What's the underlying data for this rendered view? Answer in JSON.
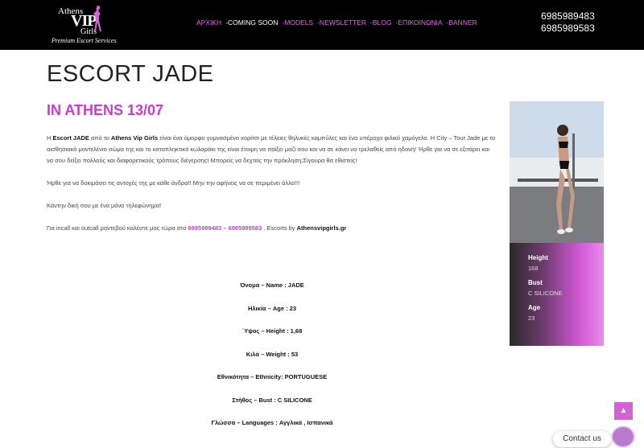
{
  "logo": {
    "line1": "Athens",
    "line2": "VIP",
    "line3": "Girls",
    "tagline": "Premium Escort Services"
  },
  "nav": [
    {
      "label": "ΑΡΧΙΚΗ"
    },
    {
      "label": "-COMING SOON"
    },
    {
      "label": "-MODELS"
    },
    {
      "label": "-NEWSLETTER"
    },
    {
      "label": "-BLOG"
    },
    {
      "label": "-ΕΠΙΚΟΙΝΩΝΙΑ"
    },
    {
      "label": "-BANNER"
    }
  ],
  "phones": [
    "6985989483",
    "6985989583"
  ],
  "page": {
    "title": "ESCORT JADE",
    "subtitle": "IN ATHENS 13/07"
  },
  "body": {
    "p1_a": "Η ",
    "p1_b": "Escort JADE",
    "p1_c": " από το ",
    "p1_d": "Athens Vip Girls",
    "p1_e": " είναι ένα όμορφο γυμνασμένο κορίτσι με τέλειες θηλυκές καμπύλες και ένα υπέροχο φιλικό χαμόγελο. Η City – Tour Jade με το αισθησιακό  μοντελένιο σώμα της και το καταπληκτικό κωλαράκι της είναι έτοιμη να παίξει μαζί σου και να σε κάνει να τρελαθείς από ηδονή!  Ήρθε για να σε εξιτάρει και να σου δείξει πολλούς και διαφορετικούς τρόπους διέγερσης! Μπορείς να δεχτείς την πρόκληση;Σίγουρα θα εθιστείς!",
    "p2": "Ήρθε για να δοκιμάσει τις αντοχές της με κάθε άνδρα!! Μην την αφήνεις να σε περιμένει άλλο!!!",
    "p3": "Κάντην δική σου με ένα μόνο τηλεφώνημα!",
    "p4_a": "Για incall και outcall ραντεβού καλέστε μας τώρα στο ",
    "p4_b": "6985989483 – 6985989583",
    "p4_c": " . Escorts by ",
    "p4_d": "Athensvipgirls.gr"
  },
  "stats": [
    "Όνομα – Name : JADE",
    "Ηλικία – Age : 23",
    "΄Υψος – Height : 1,68",
    "Κιλά – Weight : 53",
    "Εθνικότητα – Ethnicity: PORTUGUESE",
    "Στήθος – Bust :  C SILICONE",
    "Γλώσσα – Languages : Αγγλικά , Ισπανικά"
  ],
  "card": {
    "height_label": "Height",
    "height_value": "168",
    "bust_label": "Bust",
    "bust_value": "C SILICONE",
    "age_label": "Age",
    "age_value": "23"
  },
  "contact": {
    "label": "Contact us"
  },
  "colors": {
    "accent": "#c43ec9",
    "nav_link": "#e16ae6",
    "header_bg": "#000000"
  }
}
